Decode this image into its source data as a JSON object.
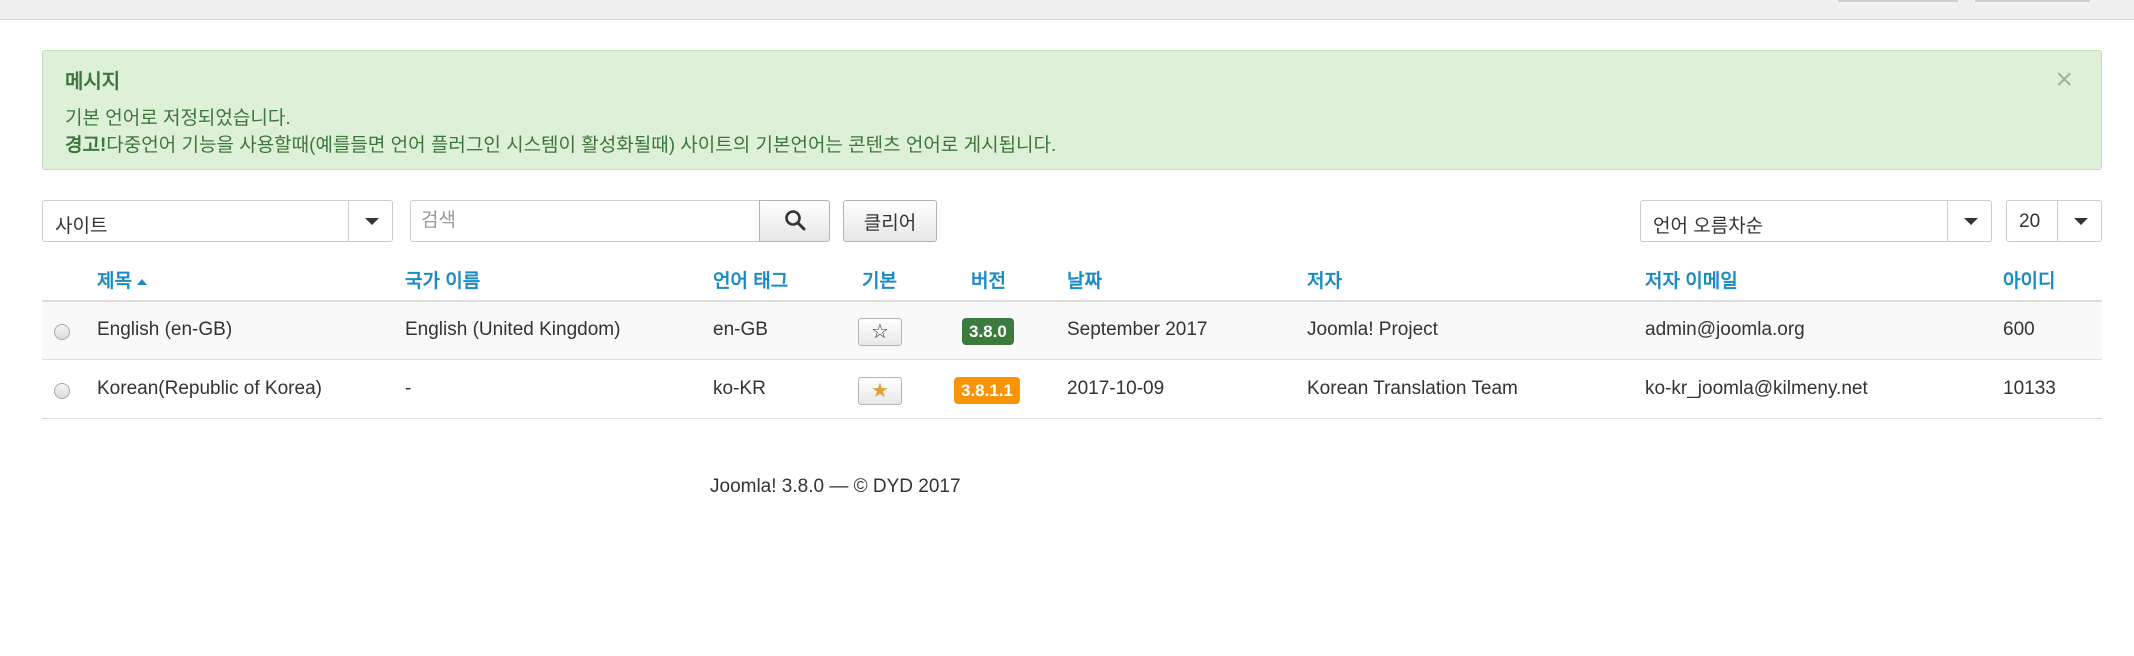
{
  "message": {
    "heading": "메시지",
    "line1": "기본 언어로 저정되었습니다.",
    "warning_label": "경고!",
    "warning_text": "다중언어 기능을 사용할때(예를들면 언어 플러그인 시스템이 활성화될때) 사이트의 기본언어는 콘텐츠 언어로 게시됩니다.",
    "close": "×"
  },
  "toolbar": {
    "client_select": "사이트",
    "search_placeholder": "검색",
    "clear_label": "클리어",
    "ordering_select": "언어 오름차순",
    "limit_select": "20"
  },
  "table": {
    "columns": [
      "제목",
      "국가 이름",
      "언어 태그",
      "기본",
      "버전",
      "날짜",
      "저자",
      "저자 이메일",
      "아이디"
    ],
    "rows": [
      {
        "title": "English (en-GB)",
        "native_name": "English (United Kingdom)",
        "tag": "en-GB",
        "default": false,
        "version": "3.8.0",
        "version_color": "#3d7a3d",
        "date": "September 2017",
        "author": "Joomla! Project",
        "email": "admin@joomla.org",
        "id": "600"
      },
      {
        "title": "Korean(Republic of Korea)",
        "native_name": "-",
        "tag": "ko-KR",
        "default": true,
        "version": "3.8.1.1",
        "version_color": "#f89406",
        "date": "2017-10-09",
        "author": "Korean Translation Team",
        "email": "ko-kr_joomla@kilmeny.net",
        "id": "10133"
      }
    ]
  },
  "footer": "Joomla! 3.8.0  —  © DYD 2017",
  "colors": {
    "link": "#1a8bc4",
    "alert_bg": "#dff0d8",
    "alert_text": "#3c763d",
    "star_active": "#e0a03a"
  }
}
